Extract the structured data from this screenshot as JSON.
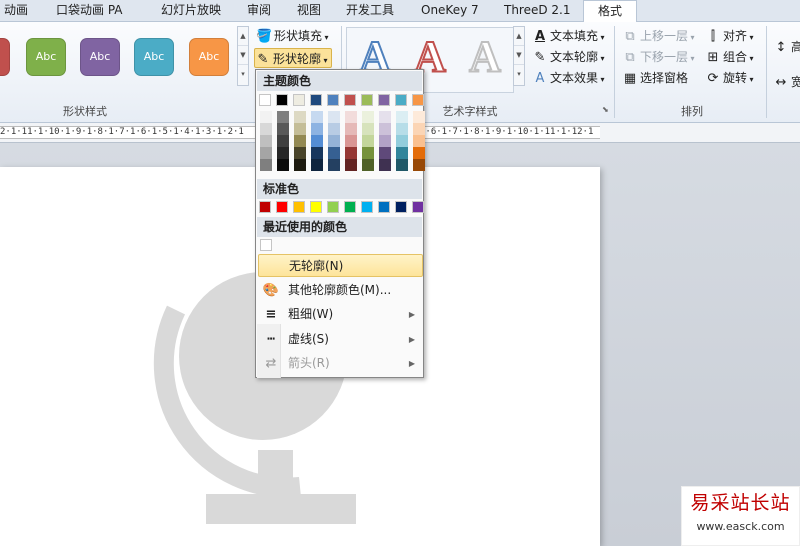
{
  "tabs": [
    "动画",
    "口袋动画 PA",
    "幻灯片放映",
    "审阅",
    "视图",
    "开发工具",
    "OneKey 7",
    "ThreeD 2.1",
    "格式"
  ],
  "shape_styles": {
    "label": "形状样式",
    "buttons": [
      {
        "text": "Abc",
        "color": "#7fb04a"
      },
      {
        "text": "Abc",
        "color": "#8064a2"
      },
      {
        "text": "Abc",
        "color": "#4bacc6"
      },
      {
        "text": "Abc",
        "color": "#f79646"
      }
    ],
    "red_edge_color": "#c0504d",
    "fill_label": "形状填充",
    "outline_label": "形状轮廓"
  },
  "wordart": {
    "label": "艺术字样式",
    "letter": "A",
    "text_fill": "文本填充",
    "text_outline": "文本轮廓",
    "text_effects": "文本效果"
  },
  "arrange": {
    "label": "排列",
    "bring_forward": "上移一层",
    "send_backward": "下移一层",
    "selection_pane": "选择窗格",
    "align": "对齐",
    "group": "组合",
    "rotate": "旋转",
    "extra1": "高",
    "extra2": "宽"
  },
  "ruler": {
    "left_text": "2·1·11·1·10·1·9·1·8·1·7·1·6·1·5·1·4·1·3·1·2·1",
    "right_text": "1·6·1·7·1·8·1·9·1·10·1·11·1·12·1"
  },
  "menu": {
    "theme_colors_label": "主题颜色",
    "standard_colors_label": "标准色",
    "recent_colors_label": "最近使用的颜色",
    "theme_top": [
      "#ffffff",
      "#000000",
      "#eeece1",
      "#1f497d",
      "#4f81bd",
      "#c0504d",
      "#9bbb59",
      "#8064a2",
      "#4bacc6",
      "#f79646"
    ],
    "theme_shades": [
      [
        "#f2f2f2",
        "#d8d8d8",
        "#bfbfbf",
        "#a5a5a5",
        "#7f7f7f"
      ],
      [
        "#7f7f7f",
        "#595959",
        "#3f3f3f",
        "#262626",
        "#0c0c0c"
      ],
      [
        "#ddd9c3",
        "#c4bd97",
        "#938953",
        "#494429",
        "#1d1b10"
      ],
      [
        "#c6d9f0",
        "#8db3e2",
        "#548dd4",
        "#17365d",
        "#0f243e"
      ],
      [
        "#dbe5f1",
        "#b8cce4",
        "#95b3d7",
        "#366092",
        "#244061"
      ],
      [
        "#f2dcdb",
        "#e5b9b7",
        "#d99694",
        "#953734",
        "#632423"
      ],
      [
        "#ebf1dd",
        "#d7e3bc",
        "#c3d69b",
        "#76923c",
        "#4f6128"
      ],
      [
        "#e5e0ec",
        "#ccc1d9",
        "#b2a2c7",
        "#5f497a",
        "#3f3151"
      ],
      [
        "#dbeef3",
        "#b7dde8",
        "#92cddc",
        "#31859b",
        "#205867"
      ],
      [
        "#fdeada",
        "#fbd5b5",
        "#fac08f",
        "#e36c09",
        "#974806"
      ]
    ],
    "standard": [
      "#c00000",
      "#ff0000",
      "#ffc000",
      "#ffff00",
      "#92d050",
      "#00b050",
      "#00b0f0",
      "#0070c0",
      "#002060",
      "#7030a0"
    ],
    "no_outline": "无轮廓(N)",
    "more_colors": "其他轮廓颜色(M)...",
    "weight": "粗细(W)",
    "dashes": "虚线(S)",
    "arrows": "箭头(R)"
  },
  "watermark": {
    "title": "易采站长站",
    "url": "www.easck.com"
  },
  "colors": {
    "globe_gray": "#d9d9d9",
    "accent_yellow": "#fde49a"
  }
}
